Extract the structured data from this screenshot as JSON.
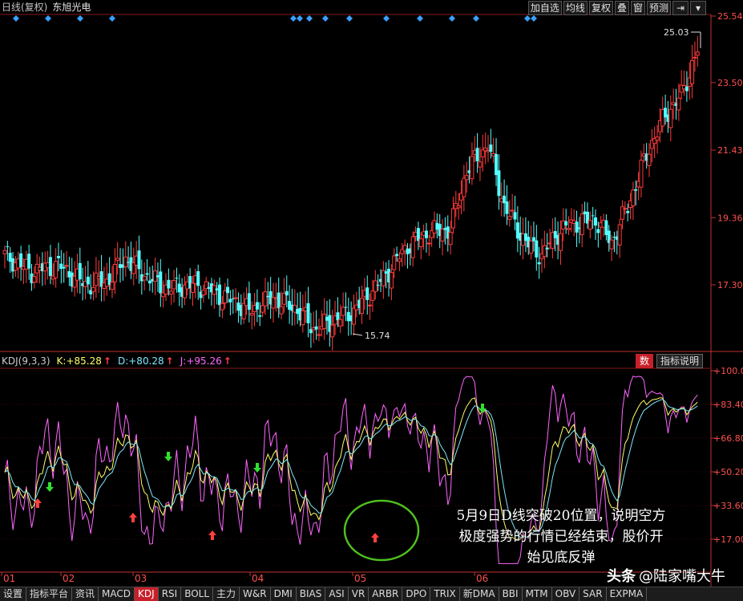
{
  "header": {
    "period": "日线(复权)",
    "stock": "东旭光电",
    "buttons": [
      "加自选",
      "均线",
      "复权",
      "叠",
      "窗",
      "预测"
    ]
  },
  "price_axis": [
    "25.54",
    "23.50",
    "21.43",
    "19.36",
    "17.30"
  ],
  "labels": {
    "high": "25.03",
    "low": "15.74"
  },
  "kdj": {
    "name": "KDJ(9,3,3)",
    "k_label": "K:",
    "k_value": "+85.28",
    "d_label": "D:",
    "d_value": "+80.28",
    "j_label": "J:",
    "j_value": "+95.26",
    "btn_shu": "数",
    "btn_help": "指标说明",
    "axis": [
      "+100.0",
      "+83.40",
      "+66.80",
      "+50.20",
      "+33.60",
      "+17.00"
    ]
  },
  "dates": [
    "01",
    "02",
    "03",
    "04",
    "05",
    "06"
  ],
  "annotation": {
    "line1": "5月9日D线突破20位置，说明空方",
    "line2": "极度强势的行情已经结束，股价开",
    "line3": "始见底反弹"
  },
  "watermark": {
    "logo": "头条",
    "author": "@陆家嘴大牛"
  },
  "tabs": [
    "设置",
    "指标平台",
    "资讯",
    "MACD",
    "KDJ",
    "RSI",
    "BOLL",
    "主力",
    "W&R",
    "DMI",
    "BIAS",
    "ASI",
    "VR",
    "ARBR",
    "DPO",
    "TRIX",
    "新DMA",
    "BBI",
    "MTM",
    "OBV",
    "SAR",
    "EXPMA"
  ],
  "active_tab": "KDJ",
  "colors": {
    "up": "#ff3b3b",
    "down": "#54ffff",
    "k_line": "#ffff66",
    "d_line": "#7fe8ff",
    "j_line": "#ff66ff",
    "axis_text": "#ff5050",
    "circle": "#4fc01e"
  }
}
